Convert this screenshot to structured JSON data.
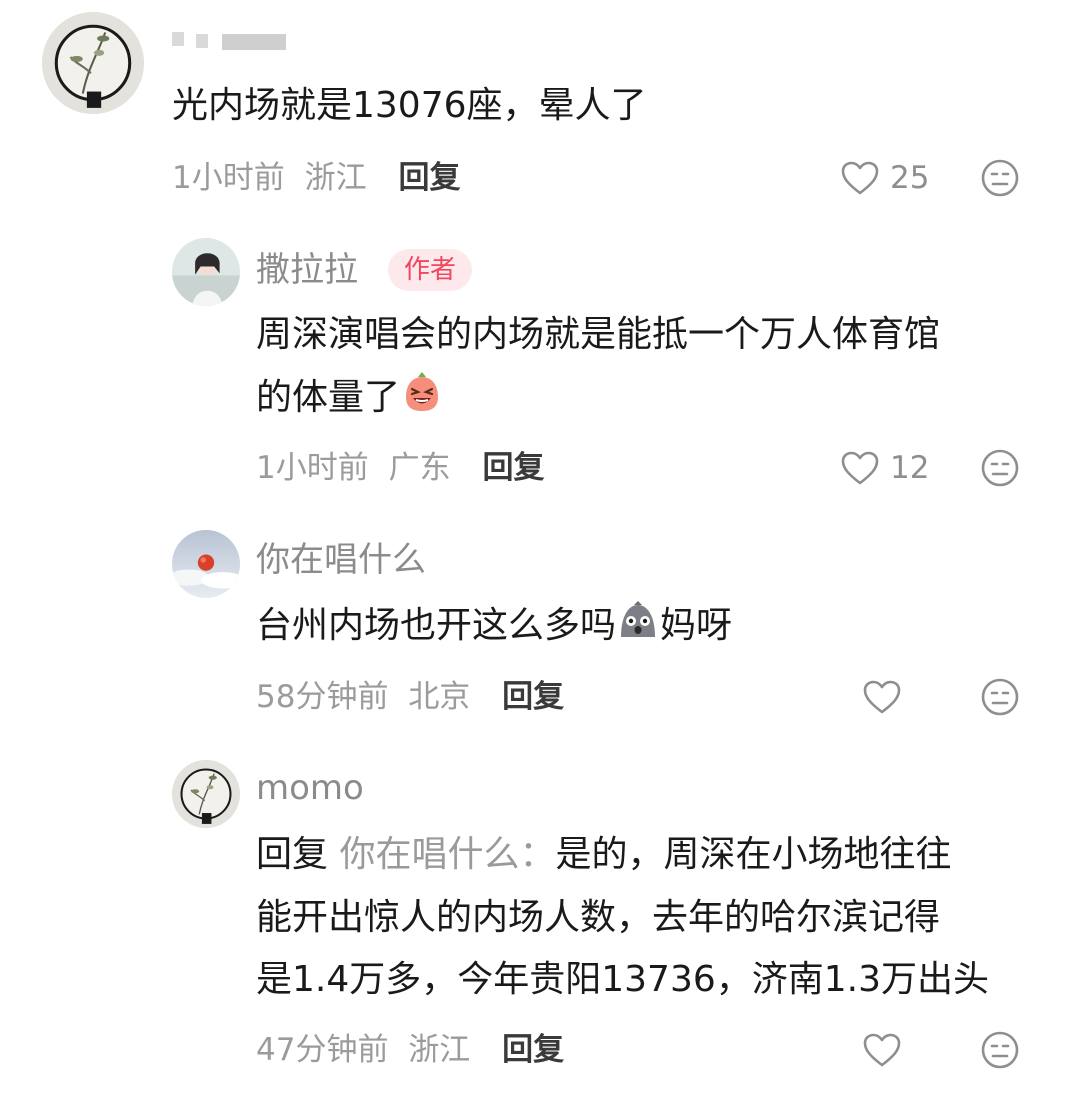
{
  "comments": [
    {
      "username": "",
      "text": "光内场就是13076座，晕人了",
      "time": "1小时前",
      "location": "浙江",
      "reply_label": "回复",
      "likes": "25",
      "avatar_icon": "plant-painting-avatar"
    },
    {
      "username": "撒拉拉",
      "badge": "作者",
      "text_line1": "周深演唱会的内场就是能抵一个万人体育馆",
      "text_line2": "的体量了",
      "emoji_icon": "laughing-face-emoji",
      "time": "1小时前",
      "location": "广东",
      "reply_label": "回复",
      "likes": "12",
      "avatar_icon": "girl-photo-avatar"
    },
    {
      "username": "你在唱什么",
      "text_before": "台州内场也开这么多吗",
      "emoji_icon": "shocked-face-emoji",
      "text_after": "妈呀",
      "time": "58分钟前",
      "location": "北京",
      "reply_label": "回复",
      "likes": "",
      "avatar_icon": "sunset-sky-avatar"
    },
    {
      "username": "momo",
      "reply_prefix": "回复",
      "reply_target": "你在唱什么：",
      "text_line1": "是的，周深在小场地往往",
      "text_line2": "能开出惊人的内场人数，去年的哈尔滨记得",
      "text_line3": "是1.4万多，今年贵阳13736，济南1.3万出头",
      "time": "47分钟前",
      "location": "浙江",
      "reply_label": "回复",
      "likes": "",
      "avatar_icon": "plant-painting-avatar"
    }
  ],
  "icons": {
    "like": "heart-outline-icon",
    "dislike": "neutral-face-icon"
  },
  "colors": {
    "badge_text": "#f0465f",
    "badge_bg": "#fde9ec",
    "meta_text": "#9b9b9b",
    "name_text": "#8b8b8b"
  }
}
